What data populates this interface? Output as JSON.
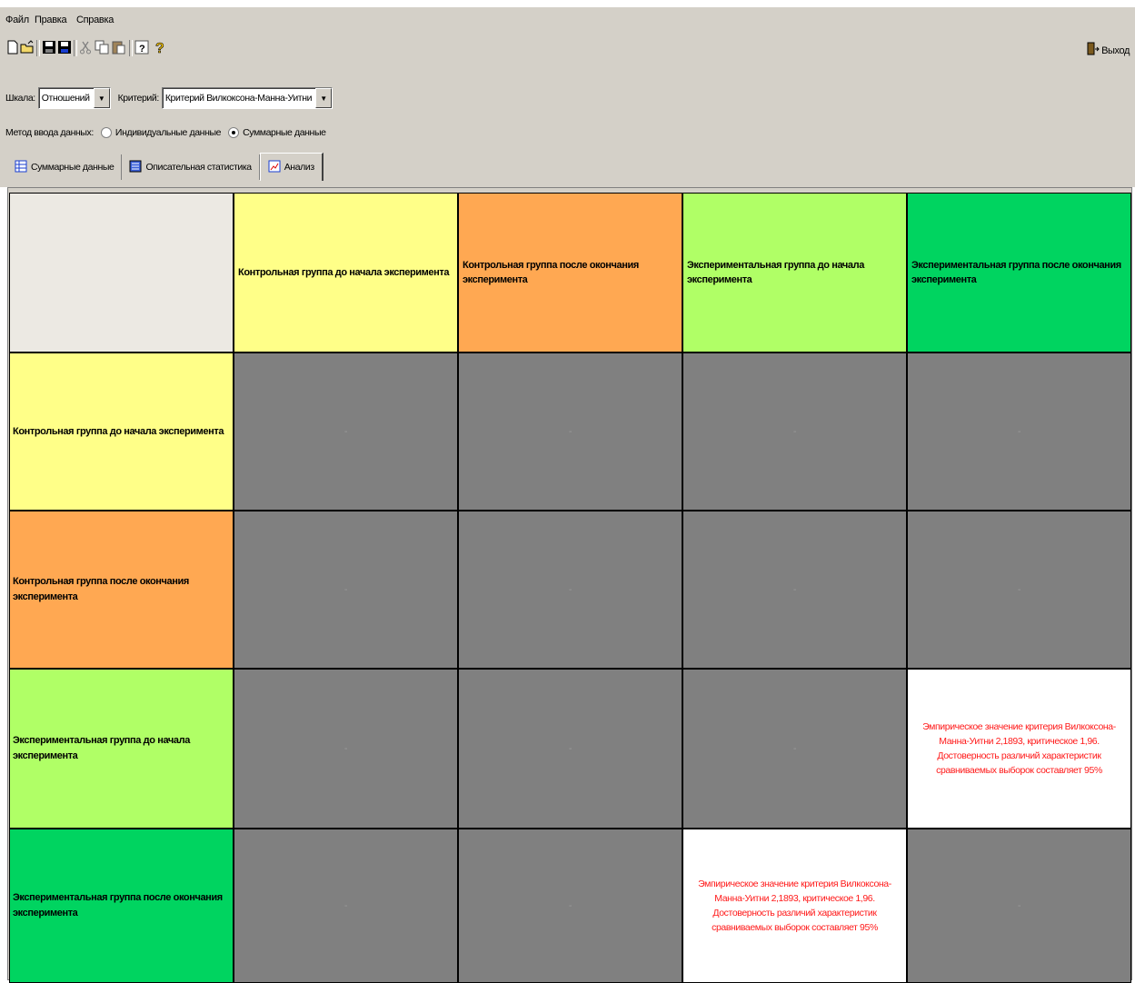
{
  "menu": [
    "Файл",
    "Правка",
    "Справка"
  ],
  "toolbar": {
    "icons": [
      "new-file-icon",
      "open-folder-icon",
      "save-icon",
      "save-as-icon",
      "cut-icon",
      "copy-icon",
      "paste-icon",
      "about-icon",
      "help-icon"
    ],
    "exit_label": "Выход"
  },
  "scale": {
    "label": "Шкала:",
    "value": "Отношений"
  },
  "criterion": {
    "label": "Критерий:",
    "value": "Критерий Вилкоксона-Манна-Уитни"
  },
  "input_method": {
    "label": "Метод ввода данных:",
    "options": [
      "Индивидуальные данные",
      "Суммарные данные"
    ],
    "selected": "Суммарные данные"
  },
  "tabs": [
    {
      "label": "Суммарные данные",
      "icon": "table-icon"
    },
    {
      "label": "Описательная статистика",
      "icon": "statistics-icon"
    },
    {
      "label": "Анализ",
      "icon": "analysis-icon",
      "active": true
    }
  ],
  "groups": [
    {
      "label": "Контрольная группа до начала эксперимента",
      "color": "#ffff88"
    },
    {
      "label": "Контрольная группа после окончания эксперимента",
      "color": "#ffa852"
    },
    {
      "label": "Экспериментальная группа до начала эксперимента",
      "color": "#b0ff66"
    },
    {
      "label": "Экспериментальная группа после окончания эксперимента",
      "color": "#00d460"
    }
  ],
  "matrix": [
    [
      "-",
      "-",
      "-",
      "-"
    ],
    [
      "-",
      "-",
      "-",
      "-"
    ],
    [
      "-",
      "-",
      "-",
      "Эмпирическое значение критерия Вилкоксона-Манна-Уитни 2,1893, критическое 1,96. Достоверность различий характеристик сравниваемых выборок составляет 95%"
    ],
    [
      "-",
      "-",
      "Эмпирическое значение критерия Вилкоксона-Манна-Уитни 2,1893, критическое 1,96. Достоверность различий характеристик сравниваемых выборок составляет 95%",
      "-"
    ]
  ],
  "colors": {
    "empty_cell": "#808080",
    "result_text": "#ff1a1a",
    "window_bg": "#d4d0c8"
  }
}
